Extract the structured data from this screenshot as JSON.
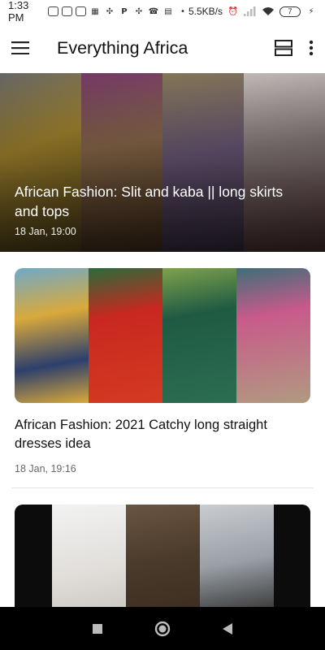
{
  "status_bar": {
    "time": "1:33 PM",
    "net_speed": "5.5KB/s",
    "battery_level": "7",
    "notification_icons": [
      "photo-icon",
      "messenger-icon",
      "mail-icon",
      "grid-icon",
      "pinwheel-icon",
      "p-icon",
      "pinwheel-icon",
      "phone-icon",
      "clipboard-icon",
      "dot-icon"
    ]
  },
  "app_bar": {
    "title": "Everything Africa"
  },
  "feed": {
    "hero": {
      "title": "African Fashion: Slit and kaba || long skirts and tops",
      "date": "18 Jan, 19:00",
      "panel_colors": [
        "#a8892f",
        "#7b5a3c",
        "#6d5a7a",
        "#9c8f8f"
      ]
    },
    "cards": [
      {
        "title": "African Fashion: 2021 Catchy long straight dresses idea",
        "date": "18 Jan, 19:16",
        "panel_colors": [
          "#d9a93b",
          "#c8281f",
          "#1f5a43",
          "#c85a8a"
        ]
      },
      {
        "title": "",
        "date": "",
        "panel_colors": [
          "#0c0c0c",
          "#e8e6e4",
          "#5a4630",
          "#b5b8bc",
          "#0c0c0c"
        ]
      }
    ]
  },
  "colors": {
    "accent": "#111111",
    "nav_bg": "#000000"
  }
}
